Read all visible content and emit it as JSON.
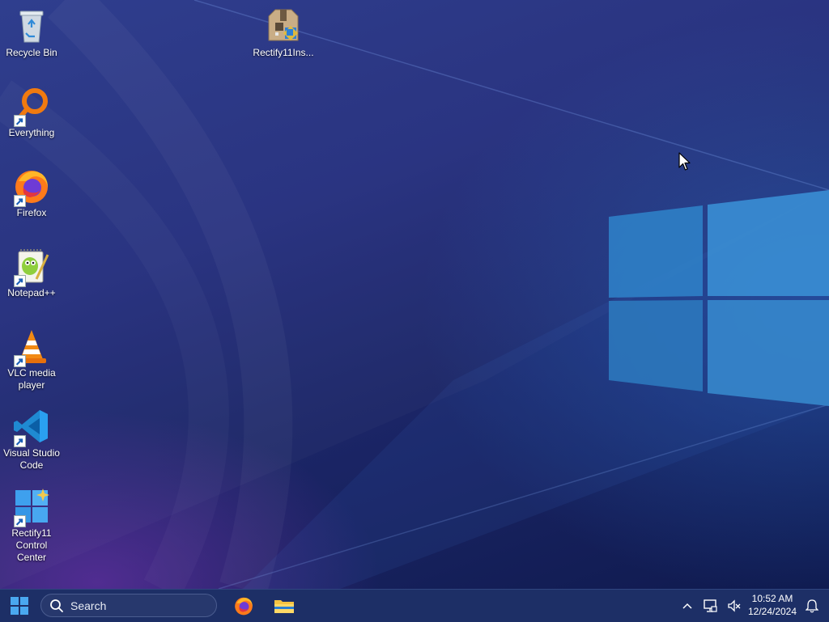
{
  "desktop": {
    "icons": [
      {
        "label": "Recycle Bin",
        "icon": "recycle-bin-icon"
      },
      {
        "label": "Everything",
        "icon": "everything-search-icon"
      },
      {
        "label": "Firefox",
        "icon": "firefox-icon"
      },
      {
        "label": "Notepad++",
        "icon": "notepad-plus-plus-icon"
      },
      {
        "label": "VLC media player",
        "icon": "vlc-icon"
      },
      {
        "label": "Visual Studio Code",
        "icon": "vscode-icon"
      },
      {
        "label": "Rectify11 Control Center",
        "icon": "rectify11-control-center-icon"
      },
      {
        "label": "Rectify11Ins...",
        "icon": "installer-package-icon"
      }
    ]
  },
  "taskbar": {
    "search_placeholder": "Search",
    "pinned": [
      "Firefox",
      "File Explorer"
    ],
    "clock_time": "10:52 AM",
    "clock_date": "12/24/2024"
  },
  "colors": {
    "taskbar_bg": "#1d2f66",
    "accent": "#3b8ee0",
    "wallpaper_dark": "#0f1a4e"
  }
}
